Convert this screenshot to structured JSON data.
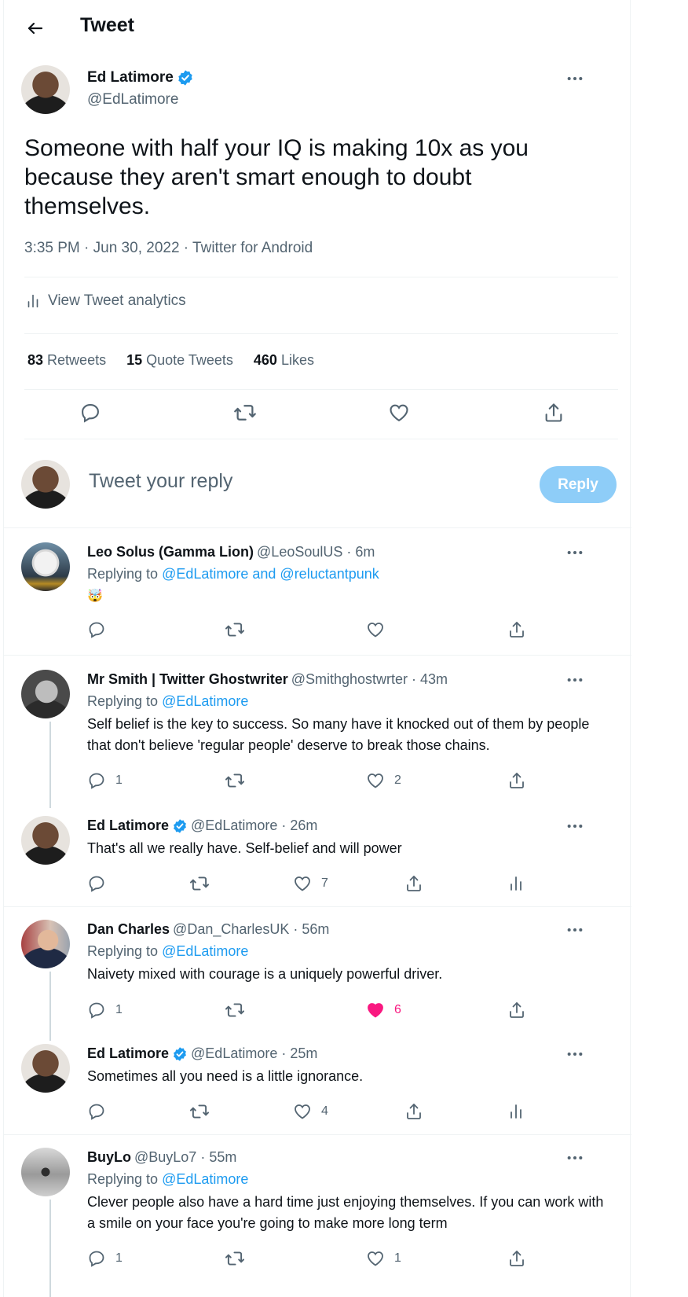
{
  "header": {
    "title": "Tweet"
  },
  "main_tweet": {
    "name": "Ed Latimore",
    "handle": "@EdLatimore",
    "text": "Someone with half your IQ is making 10x as you because they aren't smart enough to doubt themselves.",
    "meta": "3:35 PM · Jun 30, 2022 · Twitter for Android",
    "analytics_label": "View Tweet analytics",
    "retweets_count": "83",
    "retweets_label": "Retweets",
    "quotes_count": "15",
    "quotes_label": "Quote Tweets",
    "likes_count": "460",
    "likes_label": "Likes"
  },
  "composer": {
    "placeholder": "Tweet your reply",
    "button": "Reply"
  },
  "replies": [
    {
      "name": "Leo Solus (Gamma Lion)",
      "meta": "@LeoSoulUS · 6m",
      "replying_prefix": "Replying to ",
      "replying_to": "@EdLatimore and @reluctantpunk",
      "emoji": "🤯"
    },
    {
      "name": "Mr Smith | Twitter Ghostwriter",
      "meta": "@Smithghostwrter · 43m",
      "replying_prefix": "Replying to ",
      "replying_to": "@EdLatimore",
      "text": "Self belief is the key to success. So many have it knocked out of them by people that don't believe 'regular people' deserve to break those chains.",
      "replies": "1",
      "likes": "2"
    },
    {
      "name": "Ed Latimore",
      "meta": "@EdLatimore · 26m",
      "text": "That's all we really have. Self-belief and will power",
      "likes": "7"
    },
    {
      "name": "Dan Charles",
      "meta": "@Dan_CharlesUK · 56m",
      "replying_prefix": "Replying to ",
      "replying_to": "@EdLatimore",
      "text": "Naivety mixed with courage is a uniquely powerful driver.",
      "replies": "1",
      "likes": "6"
    },
    {
      "name": "Ed Latimore",
      "meta": "@EdLatimore · 25m",
      "text": "Sometimes all you need is a little ignorance.",
      "likes": "4"
    },
    {
      "name": "BuyLo",
      "meta": "@BuyLo7 · 55m",
      "replying_prefix": "Replying to ",
      "replying_to": "@EdLatimore",
      "text": "Clever people also have a hard time just enjoying themselves. If you can work with a smile on your face you're going to make more long term",
      "replies": "1",
      "likes": "1"
    }
  ],
  "colors": {
    "accent": "#1d9bf0",
    "like_active": "#f91880",
    "muted": "#536471",
    "reply_button": "#8ecdf8"
  }
}
